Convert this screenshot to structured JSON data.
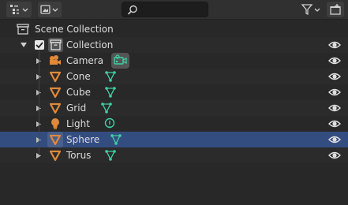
{
  "header": {
    "display_mode_icon": "outliner-display-mode-icon",
    "view_layer_icon": "view-layer-icon",
    "search": {
      "value": "",
      "placeholder": ""
    },
    "filter_icon": "funnel-icon",
    "new_collection_icon": "new-collection-icon"
  },
  "tree": {
    "root": {
      "label": "Scene Collection"
    },
    "collection": {
      "label": "Collection",
      "checked": true
    },
    "objects": [
      {
        "label": "Camera",
        "type": "camera",
        "data_icon": "camera-data-icon"
      },
      {
        "label": "Cone",
        "type": "mesh",
        "data_icon": "mesh-data-icon"
      },
      {
        "label": "Cube",
        "type": "mesh",
        "data_icon": "mesh-data-icon"
      },
      {
        "label": "Grid",
        "type": "mesh",
        "data_icon": "mesh-data-icon"
      },
      {
        "label": "Light",
        "type": "light",
        "data_icon": "light-data-icon"
      },
      {
        "label": "Sphere",
        "type": "mesh",
        "data_icon": "mesh-data-icon",
        "selected": true
      },
      {
        "label": "Torus",
        "type": "mesh",
        "data_icon": "mesh-data-icon"
      }
    ]
  },
  "colors": {
    "background": "#282828",
    "header": "#303030",
    "selection": "#334d80",
    "object_icon": "#e0893a",
    "data_icon": "#3fd0a2",
    "text": "#dcdcdc"
  }
}
